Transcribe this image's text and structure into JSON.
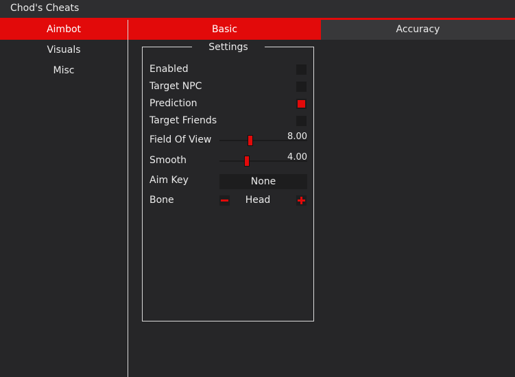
{
  "window": {
    "title": "Chod's Cheats"
  },
  "sidebar": {
    "items": [
      {
        "label": "Aimbot",
        "active": true
      },
      {
        "label": "Visuals",
        "active": false
      },
      {
        "label": "Misc",
        "active": false
      }
    ]
  },
  "tabs": [
    {
      "label": "Basic",
      "active": true
    },
    {
      "label": "Accuracy",
      "active": false
    }
  ],
  "settings": {
    "title": "Settings",
    "enabled": {
      "label": "Enabled",
      "checked": false
    },
    "target_npc": {
      "label": "Target NPC",
      "checked": false
    },
    "prediction": {
      "label": "Prediction",
      "checked": true
    },
    "target_friends": {
      "label": "Target Friends",
      "checked": false
    },
    "field_of_view": {
      "label": "Field Of View",
      "value": "8.00"
    },
    "smooth": {
      "label": "Smooth",
      "value": "4.00"
    },
    "aim_key": {
      "label": "Aim Key",
      "value": "None"
    },
    "bone": {
      "label": "Bone",
      "value": "Head"
    }
  },
  "colors": {
    "accent": "#e20a0a",
    "background": "#262628",
    "control": "#1b1b1c"
  }
}
